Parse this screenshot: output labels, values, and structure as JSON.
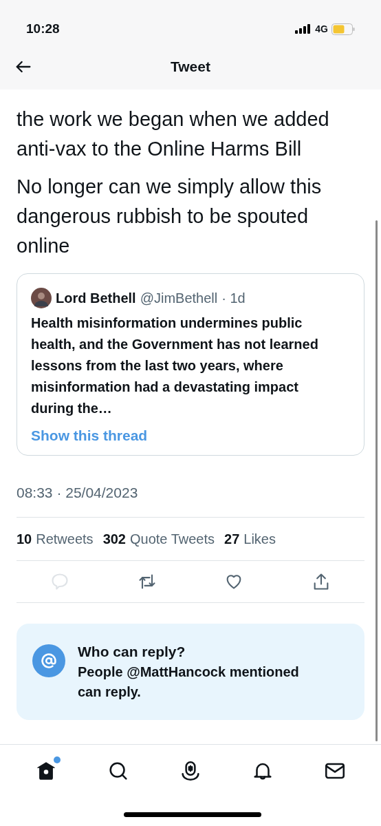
{
  "status_bar": {
    "time": "10:28",
    "network": "4G"
  },
  "header": {
    "title": "Tweet"
  },
  "tweet": {
    "paragraphs": [
      "the work we began when we added anti-vax to the Online Harms Bill",
      "No longer can we simply allow this dangerous rubbish to be spouted online"
    ],
    "quote": {
      "name": "Lord Bethell",
      "handle": "@JimBethell",
      "age": "· 1d",
      "text": "Health misinformation undermines public health, and the Government has not learned lessons from the last two years, where misinformation had a devastating impact during the…",
      "link": "Show this thread"
    },
    "timestamp": "08:33 · 25/04/2023",
    "stats": [
      {
        "count": "10",
        "label": "Retweets"
      },
      {
        "count": "302",
        "label": "Quote Tweets"
      },
      {
        "count": "27",
        "label": "Likes"
      }
    ],
    "actions": [
      {
        "kind": "reply",
        "disabled": true
      },
      {
        "kind": "retweet",
        "disabled": false
      },
      {
        "kind": "like",
        "disabled": false
      },
      {
        "kind": "share",
        "disabled": false
      }
    ]
  },
  "reply_notice": {
    "title": "Who can reply?",
    "text": "People @MattHancock mentioned can reply."
  },
  "tab_bar": [
    {
      "kind": "home",
      "selected": true,
      "badge": true
    },
    {
      "kind": "search",
      "selected": false,
      "badge": false
    },
    {
      "kind": "spaces",
      "selected": false,
      "badge": false
    },
    {
      "kind": "notifications",
      "selected": false,
      "badge": false
    },
    {
      "kind": "messages",
      "selected": false,
      "badge": false
    }
  ]
}
